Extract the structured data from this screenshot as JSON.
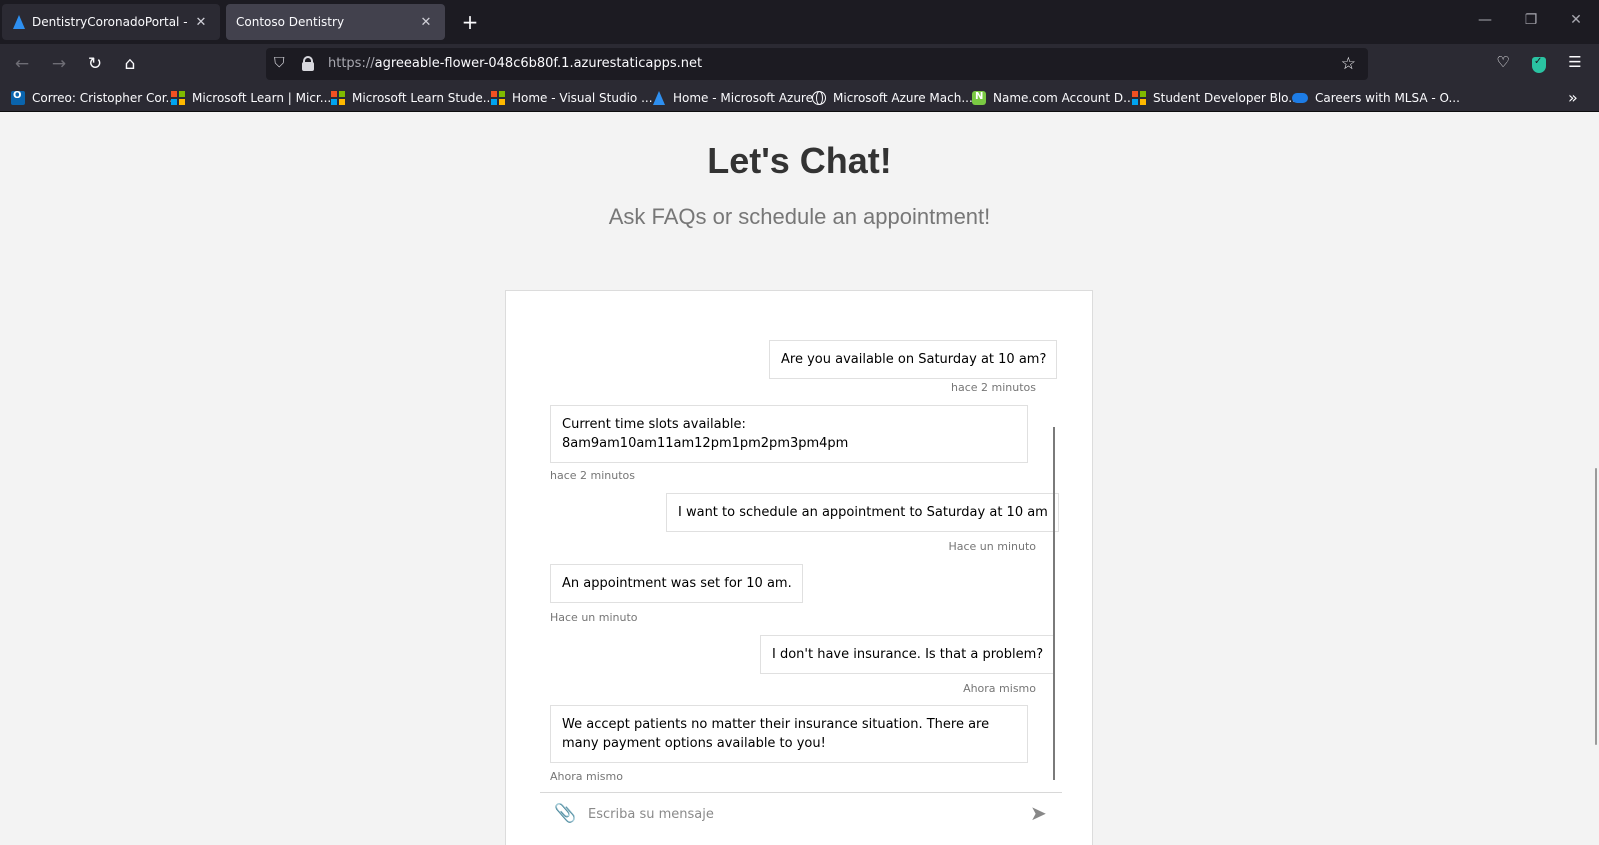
{
  "browser": {
    "tabs": [
      {
        "title": "DentistryCoronadoPortal - Mic",
        "icon": "azure-logo-icon",
        "active": false
      },
      {
        "title": "Contoso Dentistry",
        "icon": "none",
        "active": true
      }
    ],
    "new_tab_symbol": "+",
    "window_controls": {
      "minimize": "—",
      "restore": "❐",
      "close": "✕"
    },
    "nav": {
      "back": "←",
      "forward": "→",
      "reload": "↻",
      "home": "⌂"
    },
    "url": {
      "scheme": "https://",
      "host": "agreeable-flower-048c6b80f.1.azurestaticapps.net"
    },
    "right_icons": {
      "star": "☆",
      "pocket": "♡",
      "menu": "☰"
    },
    "bookmarks": [
      {
        "label": "Correo: Cristopher Cor...",
        "icon": "outlook-icon"
      },
      {
        "label": "Microsoft Learn | Micr...",
        "icon": "microsoft-icon"
      },
      {
        "label": "Microsoft Learn Stude...",
        "icon": "microsoft-icon"
      },
      {
        "label": "Home - Visual Studio ...",
        "icon": "microsoft-icon"
      },
      {
        "label": "Home - Microsoft Azure",
        "icon": "azure-icon"
      },
      {
        "label": "Microsoft Azure Mach...",
        "icon": "globe-icon"
      },
      {
        "label": "Name.com Account D...",
        "icon": "namecom-icon"
      },
      {
        "label": "Student Developer Blo...",
        "icon": "microsoft-icon"
      },
      {
        "label": "Careers with MLSA - O...",
        "icon": "onedrive-icon"
      }
    ],
    "bookmarks_more": "»"
  },
  "page": {
    "title": "Let's Chat!",
    "subtitle": "Ask FAQs or schedule an appointment!"
  },
  "chat": {
    "messages": [
      {
        "from": "user",
        "text": "Are you available on Saturday at 10 am?",
        "time": "hace 2 minutos"
      },
      {
        "from": "bot",
        "line1": "Current time slots available:",
        "line2": "8am9am10am11am12pm1pm2pm3pm4pm",
        "time": "hace 2 minutos"
      },
      {
        "from": "user",
        "text": "I want to schedule an appointment to Saturday at 10 am",
        "time": "Hace un minuto"
      },
      {
        "from": "bot",
        "text": "An appointment was set for 10 am.",
        "time": "Hace un minuto"
      },
      {
        "from": "user",
        "text": "I don't have insurance. Is that a problem?",
        "time": "Ahora mismo"
      },
      {
        "from": "bot",
        "text": "We accept patients no matter their insurance situation. There are many payment options available to you!",
        "time": "Ahora mismo"
      }
    ],
    "input_placeholder": "Escriba su mensaje",
    "attach_icon": "📎",
    "send_icon": "➤"
  }
}
